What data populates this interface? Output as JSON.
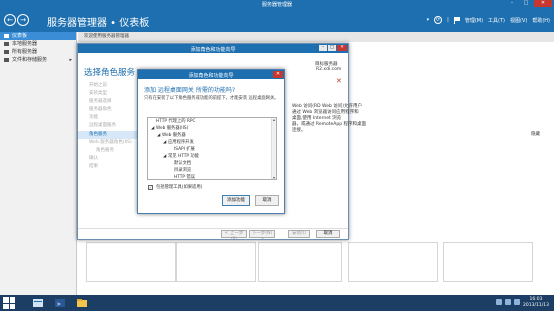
{
  "window": {
    "title": "服务器管理器"
  },
  "header": {
    "title": "服务器管理器 • 仪表板",
    "menus": [
      "管理(M)",
      "工具(T)",
      "视图(V)",
      "帮助(H)"
    ]
  },
  "sidebar": {
    "items": [
      {
        "label": "仪表板",
        "active": true
      },
      {
        "label": "本地服务器"
      },
      {
        "label": "所有服务器"
      },
      {
        "label": "文件和存储服务"
      }
    ]
  },
  "main": {
    "welcome": "欢迎使用服务器管理器",
    "hide": "隐藏"
  },
  "wizard": {
    "title": "添加角色和功能向导",
    "heading": "选择角色服务",
    "dest_label": "目标服务器",
    "dest_server": "R2.xdi.com",
    "nav": [
      {
        "label": "开始之前"
      },
      {
        "label": "安装类型"
      },
      {
        "label": "服务器选择"
      },
      {
        "label": "服务器角色"
      },
      {
        "label": "功能"
      },
      {
        "label": "远程桌面服务"
      },
      {
        "label": "角色服务",
        "active": true
      },
      {
        "label": "Web 服务器角色(IIS)"
      },
      {
        "label": "角色服务",
        "sub": true
      },
      {
        "label": "确认"
      },
      {
        "label": "结果"
      }
    ],
    "side_lines": [
      "Web 访问(RD Web 访问)允许用户",
      "通过 Web 浏览器访问应用程序和",
      "桌面,使用 Internet 浏览",
      "器，或通过 RemoteApp 程序和桌面",
      "连接。"
    ],
    "buttons": {
      "prev": "< 上一步(P)",
      "next": "下一步(N) >",
      "install": "安装(I)",
      "cancel": "取消"
    }
  },
  "dialog": {
    "title": "添加角色和功能向导",
    "heading": "添加 远程桌面网关 所需的功能吗?",
    "description": "只有在安装了以下角色服务或功能的前提下，才能安装 远程桌面网关。",
    "tree": [
      {
        "text": "HTTP 代理上的 RPC",
        "level": 0,
        "expander": ""
      },
      {
        "text": "Web 服务器(IIS)",
        "level": 0,
        "expander": "◢"
      },
      {
        "text": "Web 服务器",
        "level": 1,
        "expander": "◢"
      },
      {
        "text": "应用程序开发",
        "level": 2,
        "expander": "◢"
      },
      {
        "text": "ISAPI 扩展",
        "level": 3,
        "expander": ""
      },
      {
        "text": "常见 HTTP 功能",
        "level": 2,
        "expander": "◢"
      },
      {
        "text": "默认文档",
        "level": 3,
        "expander": ""
      },
      {
        "text": "目录浏览",
        "level": 3,
        "expander": ""
      },
      {
        "text": "HTTP 错误",
        "level": 3,
        "expander": ""
      }
    ],
    "checkbox_label": "包括管理工具(如果适用)",
    "checkbox_checked": true,
    "buttons": {
      "add": "添加功能",
      "cancel": "取消"
    }
  },
  "taskbar": {
    "clock_time": "16:03",
    "clock_date": "2013/11/13"
  }
}
